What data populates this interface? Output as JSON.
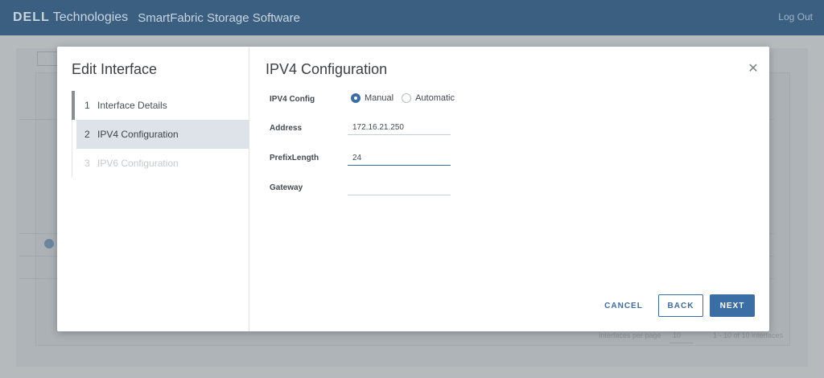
{
  "header": {
    "logo": "DELL",
    "logo_suffix": "Technologies",
    "product": "SmartFabric Storage Software",
    "logout": "Log Out"
  },
  "background": {
    "footer_per_page_label": "Interfaces per page",
    "footer_per_page_value": "10",
    "footer_count": "1 - 10 of 10 interfaces"
  },
  "modal": {
    "title": "Edit Interface",
    "steps": [
      {
        "num": "1",
        "label": "Interface Details",
        "state": "completed"
      },
      {
        "num": "2",
        "label": "IPV4 Configuration",
        "state": "active"
      },
      {
        "num": "3",
        "label": "IPV6 Configuration",
        "state": "disabled"
      }
    ],
    "section_title": "IPV4 Configuration",
    "fields": {
      "ipv4_config_label": "IPV4 Config",
      "ipv4_config_options": [
        "Manual",
        "Automatic"
      ],
      "ipv4_config_selected": "Manual",
      "address_label": "Address",
      "address_value": "172.16.21.250",
      "prefix_label": "PrefixLength",
      "prefix_value": "24",
      "gateway_label": "Gateway",
      "gateway_value": ""
    },
    "buttons": {
      "cancel": "CANCEL",
      "back": "BACK",
      "next": "NEXT"
    }
  },
  "colors": {
    "header_bg": "#3a5f80",
    "accent": "#3a6ea5"
  }
}
